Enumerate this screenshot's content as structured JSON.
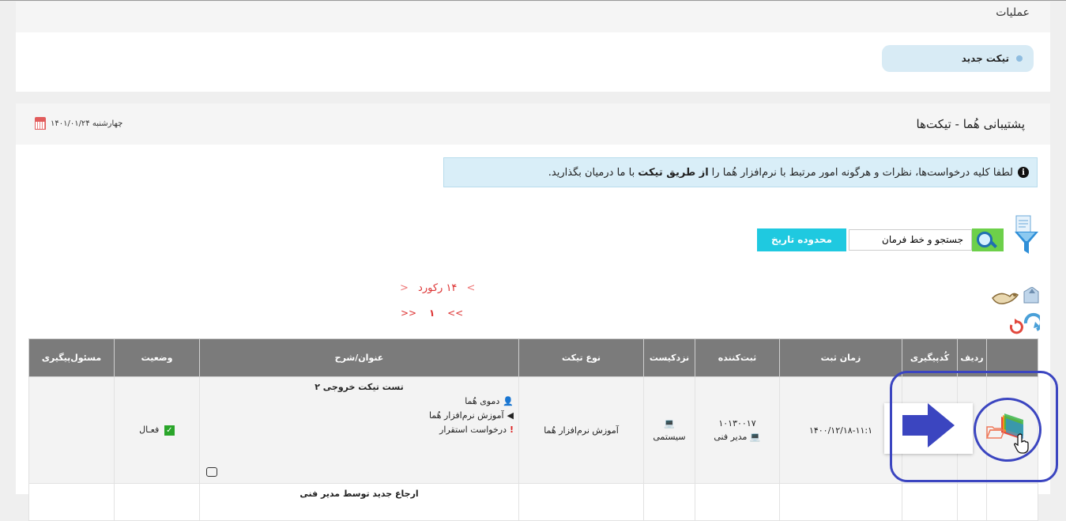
{
  "operations": {
    "title": "عملیات",
    "new_ticket_label": "تیکت جدید"
  },
  "main": {
    "title": "پشتیبانی هُما - تیکت‌ها",
    "date": "چهارشنبه ۱۴۰۱/۰۱/۲۴",
    "info_prefix": "لطفا کلیه درخواست‌ها، نظرات و هرگونه امور مرتبط با نرم‌افزار هُما را",
    "info_bold": "از طریق تیکت",
    "info_suffix": "با ما درمیان بگذارید."
  },
  "search": {
    "value": "جستجو و خط فرمان",
    "range_button": "محدوده تاریخ"
  },
  "pager": {
    "count_label": "۱۴ رکورد",
    "prev": "<",
    "next": ">",
    "first": "<<",
    "last": ">>",
    "current_page": "۱"
  },
  "table": {
    "headers": [
      "",
      "ردیف",
      "کُدپیگیری",
      "زمان ثبت",
      "ثبت‌کننده",
      "نزدکیست",
      "نوع تیکت",
      "عنوان/شرح",
      "وضعیت",
      "مسئول‌پیگیری"
    ],
    "rows": [
      {
        "row_no": "",
        "tracking_code": "",
        "created_at": "۱۴۰۰/۱۲/۱۸-۱۱:۱",
        "creator_id": "۱۰۱۳۰۰۱۷",
        "creator_name": "مدیر فنی",
        "location": "سیستمی",
        "ticket_type": "آموزش نرم‌افزار هُما",
        "title": "تست تیکت خروجی ۲",
        "line1": "دموی هُما",
        "line2": "آموزش نرم‌افزار هُما",
        "line3": "درخواست استقرار",
        "status": "فعـال",
        "owner": ""
      },
      {
        "title": "ارجاع جدید توسط مدیر فنی"
      }
    ]
  },
  "colors": {
    "header_bg": "#7b7b7b",
    "accent_cyan": "#1fc9e0",
    "info_bg": "#d9eef8",
    "annotation_blue": "#3b45c0"
  }
}
